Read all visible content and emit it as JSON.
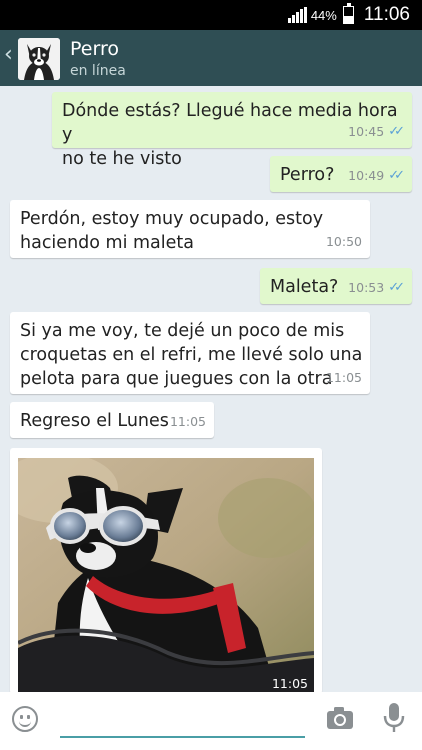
{
  "status_bar": {
    "battery_percent": "44%",
    "time": "11:06",
    "battery_level": 0.44
  },
  "header": {
    "back_icon": "chevron-left-icon",
    "contact_name": "Perro",
    "contact_status": "en línea"
  },
  "messages": [
    {
      "direction": "out",
      "text": "Dónde estás? Llegué hace media hora y\nno te he visto",
      "time": "10:45",
      "ticks": "✓✓"
    },
    {
      "direction": "out",
      "text": "Perro?",
      "time": "10:49",
      "ticks": "✓✓"
    },
    {
      "direction": "in",
      "text": "Perdón, estoy muy ocupado, estoy\nhaciendo mi maleta",
      "time": "10:50"
    },
    {
      "direction": "out",
      "text": "Maleta?",
      "time": "10:53",
      "ticks": "✓✓"
    },
    {
      "direction": "in",
      "text": "Si ya me voy, te dejé un poco de mis\ncroquetas en el refri, me llevé solo una\npelota para que juegues con la otra",
      "time": "11:05"
    },
    {
      "direction": "in",
      "text": "Regreso el Lunes",
      "time": "11:05"
    }
  ],
  "photo_message": {
    "time": "11:05"
  },
  "colors": {
    "header": "#2f4e54",
    "chat_background": "#e6ecf1",
    "outgoing_bubble": "#e1f8cd",
    "incoming_bubble": "#ffffff",
    "read_ticks": "#5aa0d6",
    "input_underline": "#4a9ea6"
  },
  "input_bar": {
    "emoji_icon": "emoji-icon",
    "camera_icon": "camera-icon",
    "mic_icon": "microphone-icon"
  }
}
